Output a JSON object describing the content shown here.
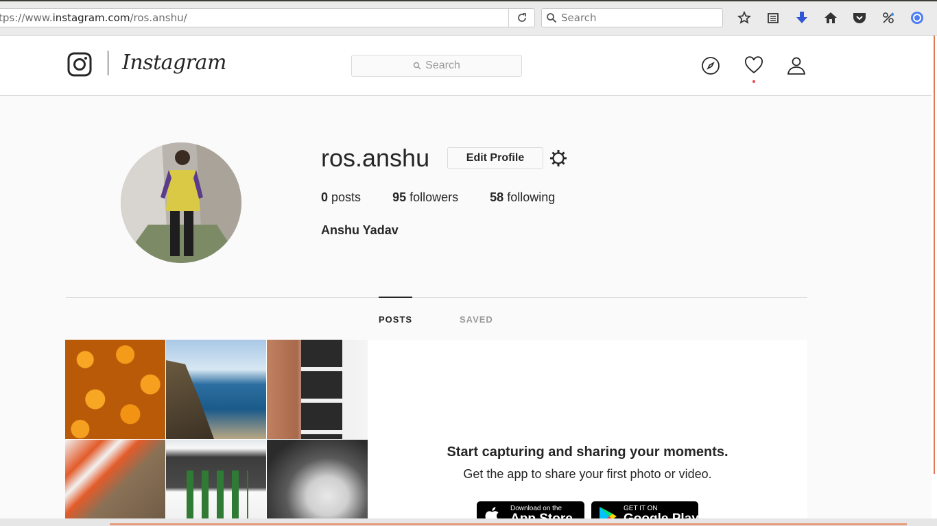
{
  "browser": {
    "url_prefix": "tps://www.",
    "url_domain": "instagram.com",
    "url_path": "/ros.anshu/",
    "search_placeholder": "Search"
  },
  "header": {
    "wordmark": "Instagram",
    "search_placeholder": "Search"
  },
  "profile": {
    "username": "ros.anshu",
    "edit_label": "Edit Profile",
    "posts_count": "0",
    "posts_label": "posts",
    "followers_count": "95",
    "followers_label": "followers",
    "following_count": "58",
    "following_label": "following",
    "full_name": "Anshu Yadav"
  },
  "tabs": [
    {
      "label": "POSTS",
      "active": true
    },
    {
      "label": "SAVED",
      "active": false
    }
  ],
  "promo": {
    "title": "Start capturing and sharing your moments.",
    "subtitle": "Get the app to share your first photo or video.",
    "appstore_small": "Download on the",
    "appstore_large": "App Store",
    "playstore_small": "GET IT ON",
    "playstore_large": "Google Play"
  },
  "colors": {
    "notification_dot": "#ed4956",
    "accent_edge": "#e07a55"
  }
}
